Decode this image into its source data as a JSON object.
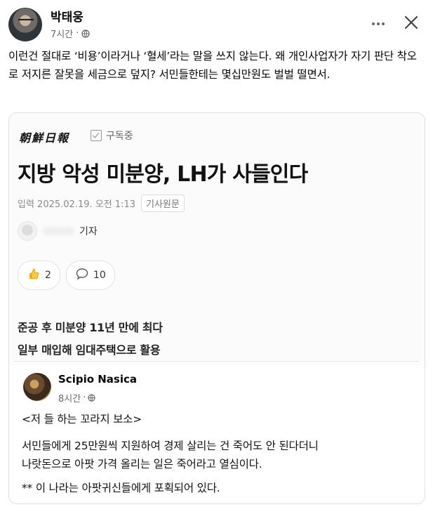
{
  "post": {
    "author": "박태웅",
    "time": "7시간",
    "text": "이런건 절대로 ‘비용’이라거나 ‘혈세’라는 말을 쓰지 않는다. 왜 개인사업자가 자기 판단 착오로 저지른 잘못을 세금으로 덮지? 서민들한테는 몇십만원도 벌벌 떨면서."
  },
  "article": {
    "newspaper": "朝鮮日報",
    "subscribe_label": "구독중",
    "headline": "지방 악성 미분양, LH가 사들인다",
    "date": "입력 2025.02.19. 오전 1:13",
    "original_tag": "기사원문",
    "reporter_suffix": "기자",
    "reactions": {
      "like_count": "2",
      "comment_count": "10"
    },
    "subheads": [
      "준공 후 미분양 11년 만에 최다",
      "일부 매입해 임대주택으로 활용"
    ]
  },
  "comment": {
    "name": "Scipio Nasica",
    "time": "8시간",
    "lines": [
      "<저       들 하는 꼬라지 보소>",
      "서민들에게 25만원씩 지원하여 경제 살리는 건 죽어도 안 된다더니",
      "나랏돈으로 아팟 가격 올리는 일은 죽어라고 열심이다.",
      "** 이 나라는 아팟귀신들에게 포획되어 있다."
    ]
  },
  "colors": {
    "text": "#050505",
    "muted": "#65676b",
    "border": "#dcdfe3"
  },
  "icons": [
    "globe-icon",
    "more-icon",
    "close-icon",
    "check-icon",
    "thumbs-up-icon",
    "speech-bubble-icon"
  ]
}
